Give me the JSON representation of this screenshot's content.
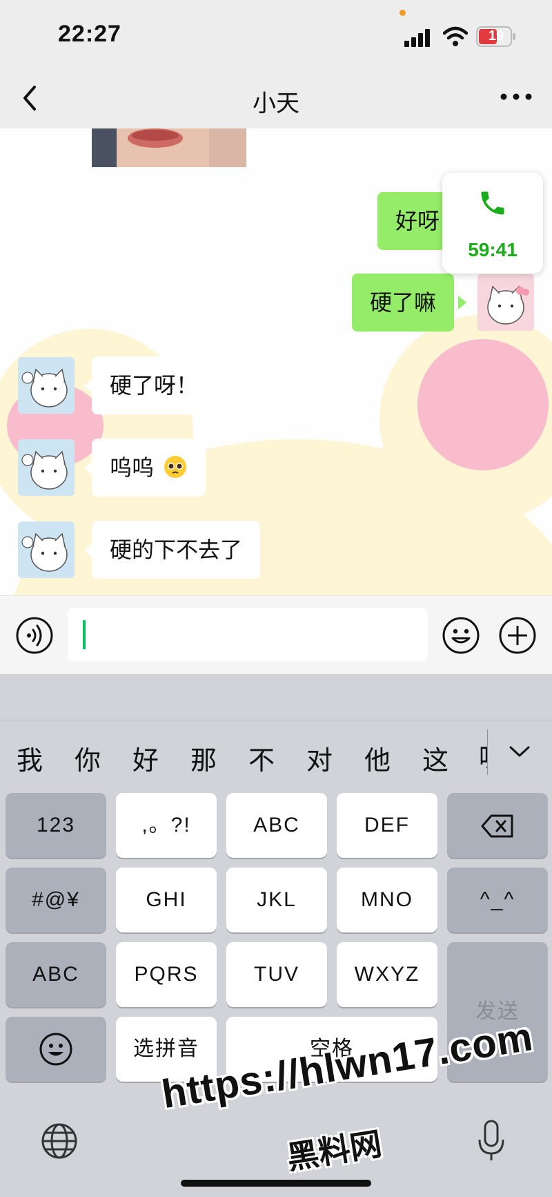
{
  "status": {
    "time": "22:27",
    "battery": "19"
  },
  "nav": {
    "title": "小天"
  },
  "messages": [
    {
      "side": "right",
      "text": "好呀"
    },
    {
      "side": "right",
      "text": "硬了嘛"
    },
    {
      "side": "left",
      "text": "硬了呀！"
    },
    {
      "side": "left",
      "text": "呜呜"
    },
    {
      "side": "left",
      "text": "硬的下不去了"
    }
  ],
  "call": {
    "timer": "59:41"
  },
  "input": {
    "value": ""
  },
  "keyboard": {
    "candidates": [
      "我",
      "你",
      "好",
      "那",
      "不",
      "对",
      "他",
      "这",
      "呢"
    ],
    "keys": {
      "k123": "123",
      "punct": ",。?!",
      "abc2": "ABC",
      "def": "DEF",
      "symbols": "#@¥",
      "ghi": "GHI",
      "jkl": "JKL",
      "mno": "MNO",
      "kaomoji": "^_^",
      "abc_switch": "ABC",
      "pqrs": "PQRS",
      "tuv": "TUV",
      "wxyz": "WXYZ",
      "pinyin": "选拼音",
      "space": "空格",
      "send": "发送"
    }
  },
  "watermark": {
    "url": "https://hlwn17.com",
    "name": "黑料网"
  },
  "colors": {
    "bubble_green": "#95ec69",
    "accent_green": "#07c160",
    "call_green": "#1aad19"
  }
}
